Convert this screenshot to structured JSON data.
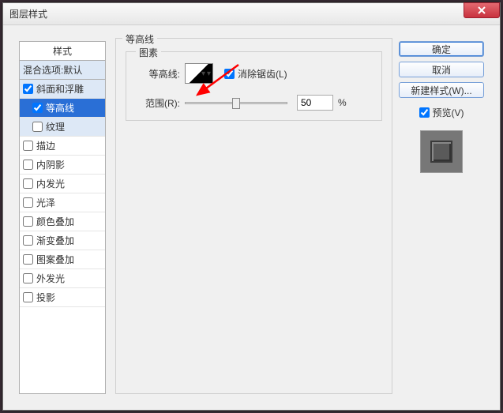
{
  "title": "图层样式",
  "styles": {
    "header": "样式",
    "blend": "混合选项:默认",
    "items": [
      {
        "label": "斜面和浮雕",
        "checked": true,
        "parentSel": true
      },
      {
        "label": "等高线",
        "checked": true,
        "indent": true,
        "selected": true
      },
      {
        "label": "纹理",
        "checked": false,
        "indent": true,
        "parentSel": true
      },
      {
        "label": "描边",
        "checked": false
      },
      {
        "label": "内阴影",
        "checked": false
      },
      {
        "label": "内发光",
        "checked": false
      },
      {
        "label": "光泽",
        "checked": false
      },
      {
        "label": "颜色叠加",
        "checked": false
      },
      {
        "label": "渐变叠加",
        "checked": false
      },
      {
        "label": "图案叠加",
        "checked": false
      },
      {
        "label": "外发光",
        "checked": false
      },
      {
        "label": "投影",
        "checked": false
      }
    ]
  },
  "center": {
    "groupTitle": "等高线",
    "innerTitle": "图素",
    "contourLabel": "等高线:",
    "antiAliasLabel": "消除锯齿(L)",
    "antiAliasChecked": true,
    "rangeLabel": "范围(R):",
    "rangeValue": "50",
    "rangeUnit": "%"
  },
  "right": {
    "ok": "确定",
    "cancel": "取消",
    "newStyle": "新建样式(W)...",
    "previewLabel": "预览(V)",
    "previewChecked": true
  }
}
